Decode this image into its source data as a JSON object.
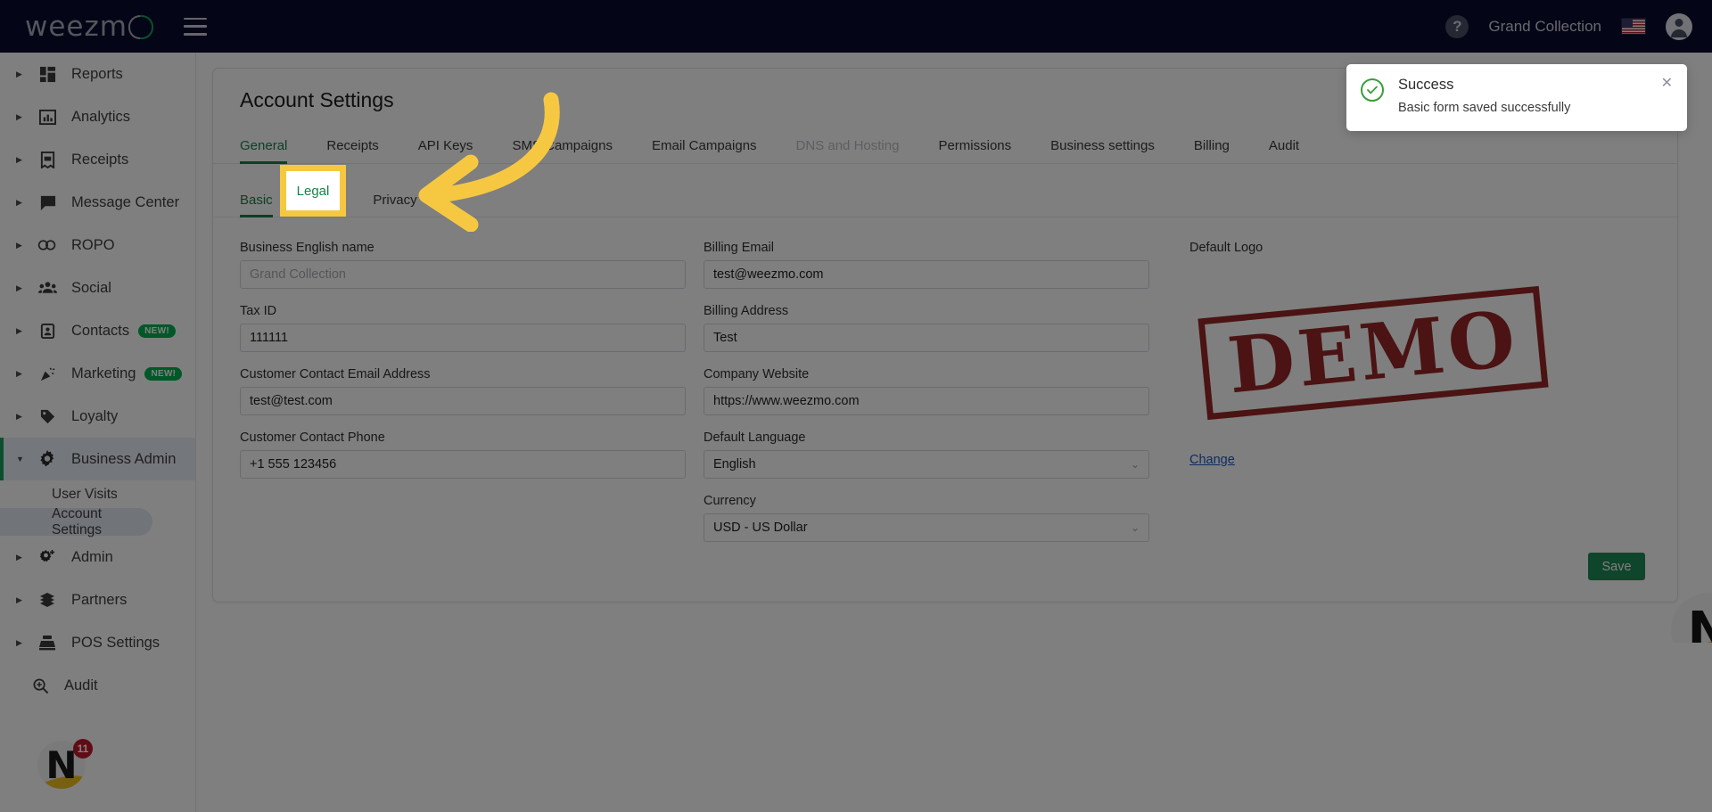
{
  "topbar": {
    "logo_text": "weezm",
    "menu_icon": "hamburger-icon",
    "help_icon": "?",
    "account_name": "Grand Collection",
    "flag": "us-flag",
    "avatar_icon": "account-circle-icon"
  },
  "sidebar": {
    "items": [
      {
        "label": "Reports",
        "icon": "dashboard-icon",
        "badge": "",
        "expandable": true
      },
      {
        "label": "Analytics",
        "icon": "bar-chart-icon",
        "badge": "",
        "expandable": true
      },
      {
        "label": "Receipts",
        "icon": "receipt-icon",
        "badge": "",
        "expandable": true
      },
      {
        "label": "Message Center",
        "icon": "chat-icon",
        "badge": "",
        "expandable": true
      },
      {
        "label": "ROPO",
        "icon": "infinity-icon",
        "badge": "",
        "expandable": true
      },
      {
        "label": "Social",
        "icon": "people-icon",
        "badge": "",
        "expandable": true
      },
      {
        "label": "Contacts",
        "icon": "contact-icon",
        "badge": "NEW!",
        "expandable": true
      },
      {
        "label": "Marketing",
        "icon": "megaphone-icon",
        "badge": "NEW!",
        "expandable": true
      },
      {
        "label": "Loyalty",
        "icon": "tag-icon",
        "badge": "",
        "expandable": true
      }
    ],
    "business_admin": {
      "label": "Business Admin",
      "icon": "gear-icon",
      "expanded": true,
      "children": [
        {
          "label": "User Visits",
          "selected": false
        },
        {
          "label": "Account Settings",
          "selected": true
        }
      ]
    },
    "items_after": [
      {
        "label": "Admin",
        "icon": "gear-plus-icon",
        "badge": "",
        "expandable": true
      },
      {
        "label": "Partners",
        "icon": "handshake-icon",
        "badge": "",
        "expandable": true
      },
      {
        "label": "POS Settings",
        "icon": "cash-register-icon",
        "badge": "",
        "expandable": true
      },
      {
        "label": "Audit",
        "icon": "magnifier-plus-icon",
        "badge": "",
        "expandable": false
      }
    ],
    "widget": {
      "logo_letter": "N",
      "badge_count": "11"
    }
  },
  "corner_widget": {
    "logo_letter": "N"
  },
  "main": {
    "page_title": "Account Settings",
    "tabs": [
      {
        "label": "General",
        "state": "active"
      },
      {
        "label": "Receipts",
        "state": "normal"
      },
      {
        "label": "API Keys",
        "state": "normal"
      },
      {
        "label": "SMS Campaigns",
        "state": "normal"
      },
      {
        "label": "Email Campaigns",
        "state": "normal"
      },
      {
        "label": "DNS and Hosting",
        "state": "disabled"
      },
      {
        "label": "Permissions",
        "state": "normal"
      },
      {
        "label": "Business settings",
        "state": "normal"
      },
      {
        "label": "Billing",
        "state": "normal"
      },
      {
        "label": "Audit",
        "state": "normal"
      }
    ],
    "subtabs": [
      {
        "label": "Basic",
        "state": "active"
      },
      {
        "label": "Legal",
        "state": "normal"
      },
      {
        "label": "Privacy",
        "state": "normal"
      }
    ],
    "left_fields": [
      {
        "label": "Business English name",
        "value": "",
        "placeholder": "Grand Collection",
        "disabled": true
      },
      {
        "label": "Tax ID",
        "value": "111111",
        "placeholder": "",
        "disabled": false
      },
      {
        "label": "Customer Contact Email Address",
        "value": "test@test.com",
        "placeholder": "",
        "disabled": false
      },
      {
        "label": "Customer Contact Phone",
        "value": "+1 555 123456",
        "placeholder": "",
        "disabled": false
      }
    ],
    "right_fields": [
      {
        "label": "Billing Email",
        "value": "test@weezmo.com",
        "type": "input"
      },
      {
        "label": "Billing Address",
        "value": "Test",
        "type": "input"
      },
      {
        "label": "Company Website",
        "value": "https://www.weezmo.com",
        "type": "input"
      },
      {
        "label": "Default Language",
        "value": "English",
        "type": "select"
      },
      {
        "label": "Currency",
        "value": "USD - US Dollar",
        "type": "select"
      }
    ],
    "logo_section": {
      "label": "Default Logo",
      "image_text": "DEMO",
      "change_label": "Change"
    },
    "save_label": "Save"
  },
  "toast": {
    "icon": "check-circle-icon",
    "title": "Success",
    "message": "Basic form saved successfully",
    "close_icon": "close-icon"
  },
  "annotation": {
    "highlight_label": "Legal",
    "arrow": "curved-arrow-pointing-left"
  },
  "colors": {
    "brand_dark": "#080b2c",
    "accent_green": "#19814a",
    "badge_green": "#00b050",
    "highlight_yellow": "#f6c842",
    "link_blue": "#1a57c4",
    "danger_red": "#c0182a",
    "stamp_red": "#8f1616"
  }
}
